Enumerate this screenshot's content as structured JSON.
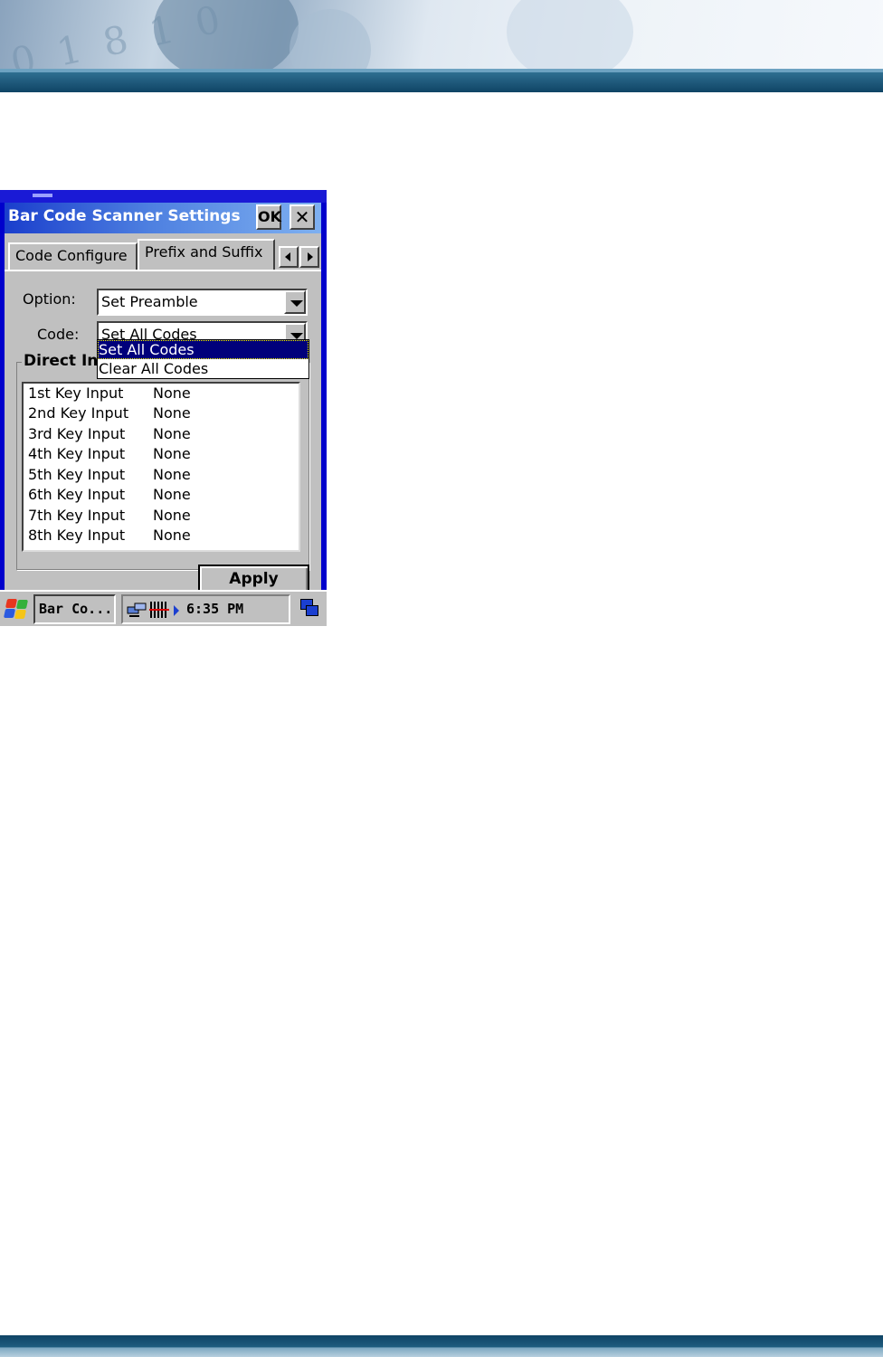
{
  "window": {
    "title": "Bar Code Scanner Settings",
    "ok_label": "OK",
    "close_label": "✕"
  },
  "tabs": [
    {
      "label": "Code Configure"
    },
    {
      "label": "Prefix and Suffix"
    }
  ],
  "form": {
    "option_label": "Option:",
    "option_value": "Set Preamble",
    "code_label": "Code:",
    "code_value": "Set All Codes"
  },
  "dropdown": {
    "options": [
      {
        "label": "Set All Codes",
        "selected": true
      },
      {
        "label": "Clear All Codes",
        "selected": false
      }
    ]
  },
  "group": {
    "title": "Direct In",
    "rows": [
      {
        "key": "1st  Key Input",
        "value": "None"
      },
      {
        "key": "2nd Key Input",
        "value": "None"
      },
      {
        "key": "3rd Key Input",
        "value": "None"
      },
      {
        "key": "4th Key Input",
        "value": "None"
      },
      {
        "key": "5th Key Input",
        "value": "None"
      },
      {
        "key": "6th Key Input",
        "value": "None"
      },
      {
        "key": "7th Key Input",
        "value": "None"
      },
      {
        "key": "8th Key Input",
        "value": "None"
      }
    ]
  },
  "apply_label": "Apply",
  "taskbar": {
    "task_label": "Bar Co...",
    "time": "6:35 PM",
    "icons": [
      "windows-start-icon",
      "network-icon",
      "barcode-icon",
      "arrow-right-icon",
      "desktop-icon"
    ]
  },
  "colors": {
    "titlebar_start": "#1a3ecc",
    "titlebar_end": "#7eb0f0",
    "selection": "#00007b",
    "window_face": "#c0c0c0",
    "page_band": "#0f4465"
  }
}
